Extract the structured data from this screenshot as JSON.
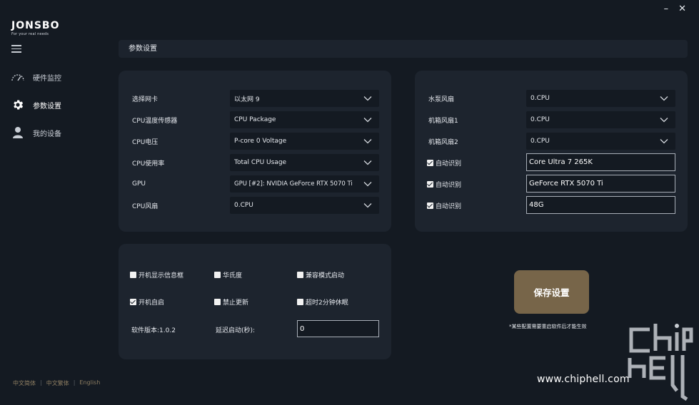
{
  "window": {
    "minimize": "–",
    "close": "✕"
  },
  "logo": {
    "mark": "JONSBO",
    "tagline": "For your real needs"
  },
  "sidebar": {
    "items": [
      {
        "label": "硬件监控",
        "icon": "speedometer-icon"
      },
      {
        "label": "参数设置",
        "icon": "gear-icon",
        "active": true
      },
      {
        "label": "我的设备",
        "icon": "user-icon"
      }
    ],
    "languages": [
      "中文简体",
      "中文繁体",
      "English"
    ],
    "sep": "|"
  },
  "header": {
    "title": "参数设置"
  },
  "left_panel": {
    "rows": [
      {
        "label": "选择网卡",
        "value": "以太网 9"
      },
      {
        "label": "CPU温度传感器",
        "value": "CPU Package"
      },
      {
        "label": "CPU电压",
        "value": "P-core 0 Voltage"
      },
      {
        "label": "CPU使用率",
        "value": "Total CPU Usage"
      },
      {
        "label": "GPU",
        "value": "GPU [#2]: NVIDIA GeForce RTX 5070 Ti"
      },
      {
        "label": "CPU风扇",
        "value": "0.CPU"
      }
    ]
  },
  "right_panel": {
    "fans": [
      {
        "label": "水泵风扇",
        "value": "0.CPU"
      },
      {
        "label": "机箱风扇1",
        "value": "0.CPU"
      },
      {
        "label": "机箱风扇2",
        "value": "0.CPU"
      }
    ],
    "auto": [
      {
        "label": "自动识别",
        "checked": true,
        "value": "Core Ultra 7 265K"
      },
      {
        "label": "自动识别",
        "checked": true,
        "value": "GeForce RTX 5070 Ti"
      },
      {
        "label": "自动识别",
        "checked": true,
        "value": "48G"
      }
    ]
  },
  "options_panel": {
    "checkboxes": [
      {
        "label": "开机显示信息框",
        "checked": false
      },
      {
        "label": "华氏度",
        "checked": false
      },
      {
        "label": "兼容模式启动",
        "checked": false
      },
      {
        "label": "开机自启",
        "checked": true
      },
      {
        "label": "禁止更新",
        "checked": false
      },
      {
        "label": "超时2分钟休眠",
        "checked": false
      }
    ],
    "version": "软件版本:1.0.2",
    "delay_label": "延迟启动(秒):",
    "delay_value": "0"
  },
  "save": {
    "label": "保存设置",
    "note": "*某些配置需要重启软件后才能生效"
  },
  "watermark": {
    "url": "www.chiphell.com"
  },
  "colors": {
    "accent": "#776549",
    "panel": "#1d242e",
    "background": "#141a22"
  }
}
